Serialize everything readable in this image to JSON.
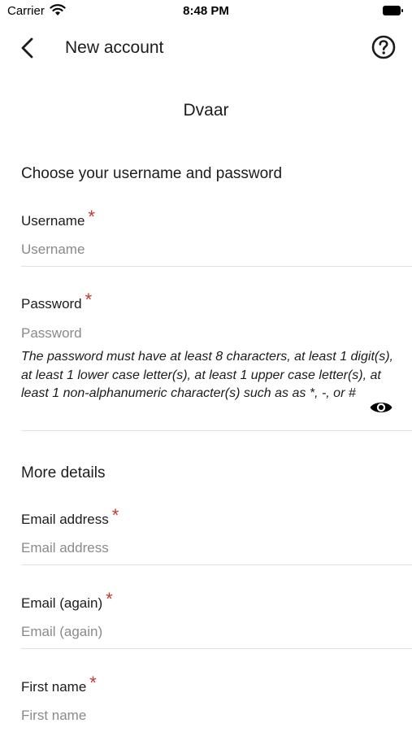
{
  "status_bar": {
    "carrier": "Carrier",
    "time": "8:48 PM"
  },
  "nav": {
    "title": "New account",
    "back_icon": "chevron-left-icon",
    "help_icon": "question-circle-icon"
  },
  "site_name": "Dvaar",
  "section_credentials": {
    "title": "Choose your username and password",
    "username": {
      "label": "Username",
      "required_mark": "*",
      "placeholder": "Username",
      "value": ""
    },
    "password": {
      "label": "Password",
      "required_mark": "*",
      "placeholder": "Password",
      "value": "",
      "hint": "The password must have at least 8 characters, at least 1 digit(s), at least 1 lower case letter(s), at least 1 upper case letter(s), at least 1 non-alphanumeric character(s) such as as *, -, or #",
      "toggle_icon": "eye-icon"
    }
  },
  "section_details": {
    "title": "More details",
    "email": {
      "label": "Email address",
      "required_mark": "*",
      "placeholder": "Email address",
      "value": ""
    },
    "email_again": {
      "label": "Email (again)",
      "required_mark": "*",
      "placeholder": "Email (again)",
      "value": ""
    },
    "first_name": {
      "label": "First name",
      "required_mark": "*",
      "placeholder": "First name",
      "value": ""
    }
  },
  "colors": {
    "required": "#c0392b",
    "text": "#1c1c1e",
    "placeholder": "#8a8a8e",
    "divider": "#e2e2e2"
  }
}
